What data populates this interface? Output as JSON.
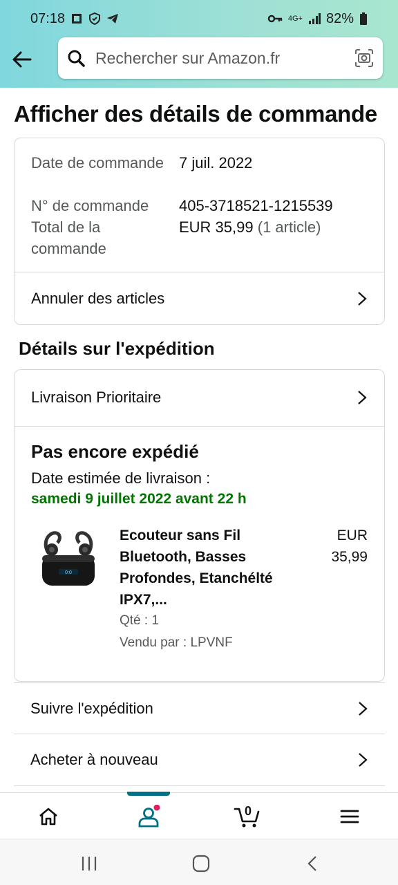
{
  "status_bar": {
    "time": "07:18",
    "battery": "82%",
    "network": "4G+",
    "icons": [
      "sim-icon",
      "shield-icon",
      "telegram-icon",
      "key-icon",
      "signal-icon",
      "battery-icon"
    ]
  },
  "search": {
    "placeholder": "Rechercher sur Amazon.fr"
  },
  "page": {
    "title": "Afficher des détails de commande"
  },
  "order_summary": {
    "date_label": "Date de commande",
    "date_value": "7 juil. 2022",
    "number_label": "N° de commande",
    "number_value": "405-3718521-1215539",
    "total_label": "Total de la commande",
    "total_value": "EUR 35,99",
    "total_items": "(1 article)",
    "cancel_label": "Annuler des articles"
  },
  "shipping": {
    "section_title": "Détails sur l'expédition",
    "method": "Livraison Prioritaire",
    "status": "Pas encore expédié",
    "estimate_label": "Date estimée de livraison :",
    "estimate_date": "samedi 9 juillet 2022 avant 22 h"
  },
  "product": {
    "title": "Ecouteur sans Fil Bluetooth, Basses Profondes, Etanchélté IPX7,...",
    "price": "EUR 35,99",
    "quantity": "Qté : 1",
    "seller": "Vendu par : LPVNF"
  },
  "actions": {
    "track": "Suivre l'expédition",
    "buy_again": "Acheter à nouveau"
  },
  "bottom_nav": {
    "cart_count": "0",
    "active_color": "#007185",
    "badge_color": "#e11d64"
  },
  "colors": {
    "header_gradient": "#80d7dd",
    "delivery_green": "#007600"
  }
}
